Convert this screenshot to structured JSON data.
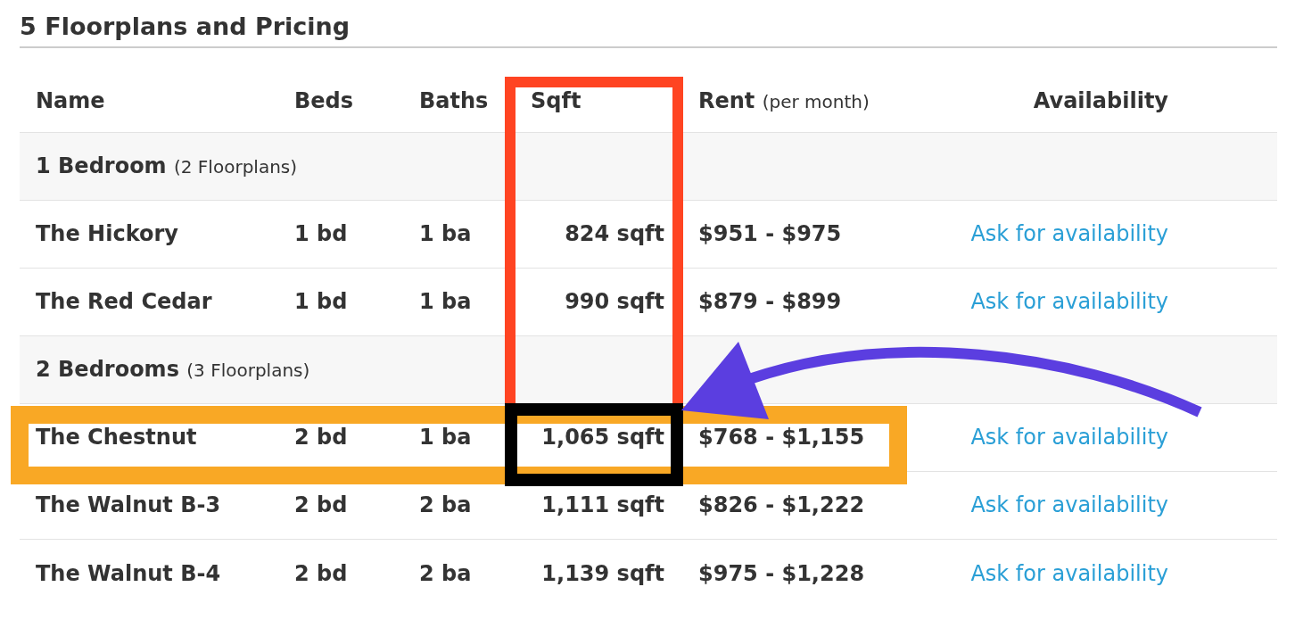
{
  "title": "5 Floorplans and Pricing",
  "table": {
    "columns": [
      {
        "label": "Name"
      },
      {
        "label": "Beds"
      },
      {
        "label": "Baths"
      },
      {
        "label": "Sqft"
      },
      {
        "label": "Rent",
        "note": "(per month)"
      },
      {
        "label": "Availability"
      }
    ],
    "groups": [
      {
        "label": "1 Bedroom",
        "count": "(2 Floorplans)",
        "rows": [
          {
            "name": "The Hickory",
            "beds": "1 bd",
            "baths": "1 ba",
            "sqft": "824 sqft",
            "rent": "$951 - $975",
            "availability": "Ask for availability"
          },
          {
            "name": "The Red Cedar",
            "beds": "1 bd",
            "baths": "1 ba",
            "sqft": "990 sqft",
            "rent": "$879 - $899",
            "availability": "Ask for availability"
          }
        ]
      },
      {
        "label": "2 Bedrooms",
        "count": "(3 Floorplans)",
        "rows": [
          {
            "name": "The Chestnut",
            "beds": "2 bd",
            "baths": "1 ba",
            "sqft": "1,065 sqft",
            "rent": "$768 - $1,155",
            "availability": "Ask for availability"
          },
          {
            "name": "The Walnut B-3",
            "beds": "2 bd",
            "baths": "2 ba",
            "sqft": "1,111 sqft",
            "rent": "$826 - $1,222",
            "availability": "Ask for availability"
          },
          {
            "name": "The Walnut B-4",
            "beds": "2 bd",
            "baths": "2 ba",
            "sqft": "1,139 sqft",
            "rent": "$975 - $1,228",
            "availability": "Ask for availability"
          }
        ]
      }
    ]
  },
  "annotations": [
    {
      "kind": "row-frame",
      "color": "#f9a825"
    },
    {
      "kind": "column-frame",
      "color": "#ff4422"
    },
    {
      "kind": "cell-frame",
      "color": "#000000"
    },
    {
      "kind": "arrow",
      "color": "#5b3ee0"
    }
  ]
}
